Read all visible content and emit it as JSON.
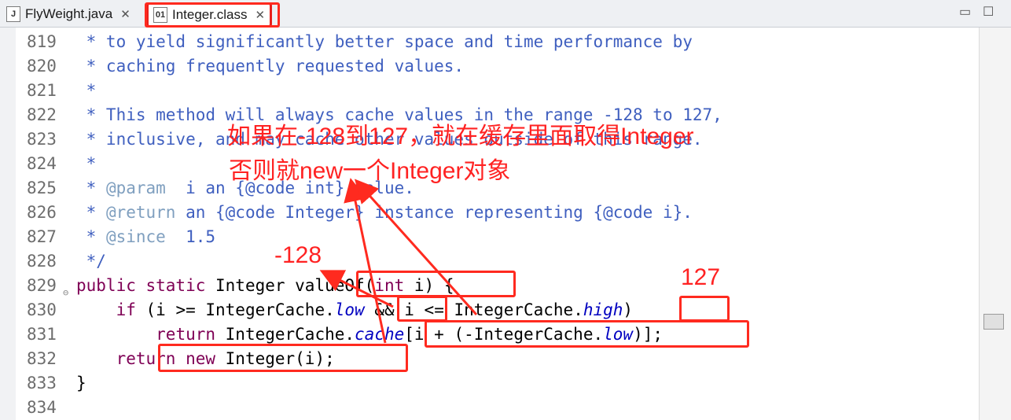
{
  "tabs": [
    {
      "label": "FlyWeight.java",
      "icon": "java-file-icon"
    },
    {
      "label": "Integer.class",
      "icon": "class-file-icon"
    }
  ],
  "window": {
    "minimize": "▭",
    "maximize": "☐"
  },
  "lines": [
    {
      "num": "819",
      "parts": [
        [
          " * to yield significantly better space and time performance by",
          "doc"
        ]
      ]
    },
    {
      "num": "820",
      "parts": [
        [
          " * caching frequently requested values.",
          "doc"
        ]
      ]
    },
    {
      "num": "821",
      "parts": [
        [
          " *",
          "doc"
        ]
      ]
    },
    {
      "num": "822",
      "parts": [
        [
          " * This method will always cache values in the range -128 to 127,",
          "doc"
        ]
      ]
    },
    {
      "num": "823",
      "parts": [
        [
          " * inclusive, and may cache other values outside of this range.",
          "doc"
        ]
      ]
    },
    {
      "num": "824",
      "parts": [
        [
          " *",
          "doc"
        ]
      ]
    },
    {
      "num": "825",
      "parts": [
        [
          " * ",
          "doc"
        ],
        [
          "@param",
          "tag"
        ],
        [
          "  i an {@code int} value.",
          "doc"
        ]
      ]
    },
    {
      "num": "826",
      "parts": [
        [
          " * ",
          "doc"
        ],
        [
          "@return",
          "tag"
        ],
        [
          " an {@code Integer} instance representing {@code i}.",
          "doc"
        ]
      ]
    },
    {
      "num": "827",
      "parts": [
        [
          " * ",
          "doc"
        ],
        [
          "@since",
          "tag"
        ],
        [
          "  1.5",
          "doc"
        ]
      ]
    },
    {
      "num": "828",
      "parts": [
        [
          " */",
          "doc"
        ]
      ]
    },
    {
      "num": "829",
      "fold": "⊖",
      "parts": [
        [
          "public static ",
          "kw"
        ],
        [
          "Integer valueOf(",
          "plain"
        ],
        [
          "int",
          "kw"
        ],
        [
          " i) {",
          "plain"
        ]
      ]
    },
    {
      "num": "830",
      "parts": [
        [
          "    ",
          "plain"
        ],
        [
          "if",
          "kw"
        ],
        [
          " (i >= IntegerCache.",
          "plain"
        ],
        [
          "low",
          "fld"
        ],
        [
          " && i <= IntegerCache.",
          "plain"
        ],
        [
          "high",
          "fld"
        ],
        [
          ")",
          "plain"
        ]
      ]
    },
    {
      "num": "831",
      "parts": [
        [
          "        ",
          "plain"
        ],
        [
          "return",
          "kw"
        ],
        [
          " IntegerCache.",
          "plain"
        ],
        [
          "cache",
          "fld"
        ],
        [
          "[i + (-IntegerCache.",
          "plain"
        ],
        [
          "low",
          "fld"
        ],
        [
          ")];",
          "plain"
        ]
      ]
    },
    {
      "num": "832",
      "parts": [
        [
          "    ",
          "plain"
        ],
        [
          "return new",
          "kw"
        ],
        [
          " Integer(i);",
          "plain"
        ]
      ]
    },
    {
      "num": "833",
      "parts": [
        [
          "}",
          "plain"
        ]
      ]
    },
    {
      "num": "834",
      "parts": [
        [
          "",
          "plain"
        ]
      ]
    }
  ],
  "annotations": {
    "main_note_line1": "如果在-128到127，就在缓存里面取得Integer",
    "main_note_line2": "否则就new一个Integer对象",
    "low_value": "-128",
    "high_value": "127"
  },
  "colors": {
    "annotation": "#ff2222",
    "javadoc": "#3f5fbf",
    "keyword": "#7f0055",
    "field": "#0000c0"
  }
}
